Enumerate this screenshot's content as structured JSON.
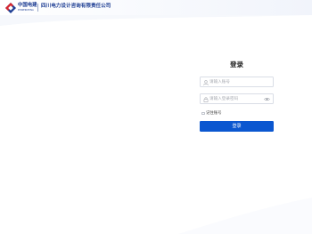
{
  "header": {
    "logo_cn": "中国电建",
    "logo_en": "POWERCHINA",
    "company_name": "四川电力设计咨询有限责任公司"
  },
  "login": {
    "title": "登录",
    "username_placeholder": "请输入账号",
    "password_placeholder": "请输入登录密码",
    "remember_label": "记住账号",
    "submit_label": "登录"
  },
  "colors": {
    "brand_blue": "#1f3f94",
    "button_blue": "#0b57d0",
    "logo_red": "#d6262f"
  },
  "icons": {
    "user": "user-icon",
    "lock": "lock-icon",
    "eye": "eye-icon",
    "logo": "powerchina-logo-icon"
  }
}
